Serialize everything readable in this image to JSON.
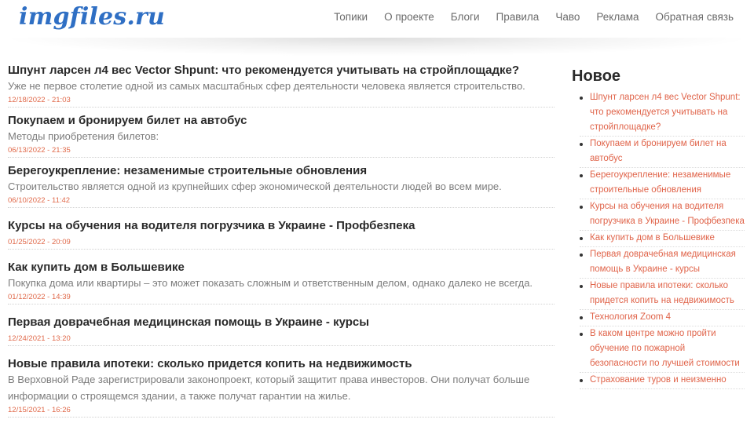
{
  "site": {
    "logo": "imgfiles.ru"
  },
  "nav": [
    {
      "label": "Топики"
    },
    {
      "label": "О проекте"
    },
    {
      "label": "Блоги"
    },
    {
      "label": "Правила"
    },
    {
      "label": "Чаво"
    },
    {
      "label": "Реклама"
    },
    {
      "label": "Обратная связь"
    }
  ],
  "posts": [
    {
      "title": "Шпунт ларсен л4 вес Vector Shpunt: что рекомендуется учитывать на стройплощадке?",
      "excerpt": "Уже не первое столетие одной из самых масштабных сфер деятельности человека является строительство.",
      "date": "12/18/2022 - 21:03"
    },
    {
      "title": "Покупаем и бронируем билет на автобус",
      "excerpt": "Методы приобретения билетов:",
      "date": "06/13/2022 - 21:35"
    },
    {
      "title": "Берегоукрепление: незаменимые строительные обновления",
      "excerpt": "Строительство является одной из крупнейших сфер экономической деятельности людей во всем мире.",
      "date": "06/10/2022 - 11:42"
    },
    {
      "title": "Курсы на обучения на водителя погрузчика в Украине - Профбезпека",
      "excerpt": "",
      "date": "01/25/2022 - 20:09"
    },
    {
      "title": "Как купить дом в Большевике",
      "excerpt": "Покупка дома или квартиры – это может показать сложным и ответственным делом, однако далеко не всегда.",
      "date": "01/12/2022 - 14:39"
    },
    {
      "title": "Первая доврачебная медицинская помощь в Украине - курсы",
      "excerpt": "",
      "date": "12/24/2021 - 13:20"
    },
    {
      "title": "Новые правила ипотеки: сколько придется копить на недвижимость",
      "excerpt": "В Верховной Раде зарегистрировали законопроект, который защитит права инвесторов. Они получат больше информации о строящемся здании, а также получат гарантии на жилье.",
      "date": "12/15/2021 - 16:26"
    }
  ],
  "sidebar": {
    "title": "Новое",
    "items": [
      {
        "label": "Шпунт ларсен л4 вес Vector Shpunt: что рекомендуется учитывать на стройплощадке?"
      },
      {
        "label": "Покупаем и бронируем билет на автобус"
      },
      {
        "label": "Берегоукрепление: незаменимые строительные обновления"
      },
      {
        "label": "Курсы на обучения на водителя погрузчика в Украине - Профбезпека"
      },
      {
        "label": "Как купить дом в Большевике"
      },
      {
        "label": "Первая доврачебная медицинская помощь в Украине - курсы"
      },
      {
        "label": "Новые правила ипотеки: сколько придется копить на недвижимость"
      },
      {
        "label": "Технология Zoom 4"
      },
      {
        "label": "В каком центре можно пройти обучение по пожарной безопасности по лучшей стоимости"
      },
      {
        "label": "Страхование туров и неизменно"
      }
    ]
  },
  "colors": {
    "logo": "#2f6fc4",
    "accent": "#e0644a",
    "text": "#2a2a2a",
    "muted": "#7c7c7c"
  }
}
